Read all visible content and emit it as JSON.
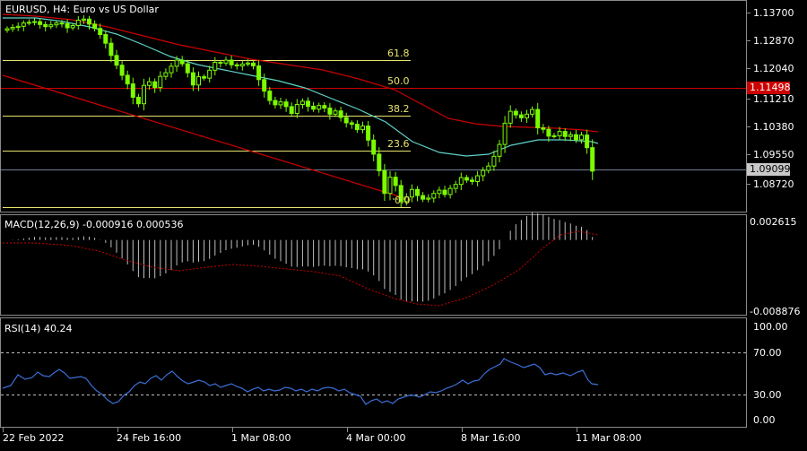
{
  "window": {
    "symbol_title": "EURUSD, H4:  Euro vs US Dollar"
  },
  "indicators": {
    "macd_label": "MACD(12,26,9) -0.000916 0.000536",
    "rsi_label": "RSI(14) 40.24"
  },
  "price_axis": {
    "ticks": [
      "1.13700",
      "1.12870",
      "1.12040",
      "1.11210",
      "1.10380",
      "1.09550",
      "1.08720"
    ],
    "current_price": "1.09099",
    "level_price": "1.11498",
    "level_color": "#cc0000",
    "current_color": "#c9c9c9"
  },
  "macd_axis": {
    "top": "0.002615",
    "bottom": "-0.008876"
  },
  "rsi_axis": {
    "ticks": [
      "100.00",
      "70.00",
      "30.00",
      "0.00"
    ]
  },
  "time_axis": {
    "labels": [
      "22 Feb 2022",
      "24 Feb 16:00",
      "1 Mar 08:00",
      "4 Mar 00:00",
      "8 Mar 16:00",
      "11 Mar 08:00"
    ]
  },
  "fibonacci": {
    "levels": [
      "61.8",
      "50.0",
      "38.2",
      "23.6",
      "0.0"
    ],
    "color": "#e8e36c"
  },
  "colors": {
    "background": "#000000",
    "bull_candle": "#7cfc00",
    "ma_fast": "#5fd3c8",
    "ma_slow": "#cc0000",
    "macd_hist": "#c0c0c0",
    "macd_signal": "#cc0000",
    "rsi_line": "#3b6fd6",
    "grid": "#444444"
  },
  "chart_data": [
    {
      "type": "candlestick",
      "title": "EURUSD, H4:  Euro vs US Dollar",
      "ylim": [
        1.082,
        1.14
      ],
      "close": [
        1.1325,
        1.1329,
        1.1332,
        1.1341,
        1.1343,
        1.1345,
        1.1337,
        1.1331,
        1.1336,
        1.1341,
        1.1339,
        1.1328,
        1.1334,
        1.1349,
        1.1352,
        1.1338,
        1.1326,
        1.1309,
        1.1285,
        1.1251,
        1.1224,
        1.1196,
        1.1172,
        1.1135,
        1.1117,
        1.1168,
        1.1178,
        1.1162,
        1.1193,
        1.1203,
        1.1221,
        1.1238,
        1.1228,
        1.1203,
        1.1169,
        1.1192,
        1.1188,
        1.121,
        1.1232,
        1.123,
        1.1238,
        1.1225,
        1.1222,
        1.1227,
        1.123,
        1.1222,
        1.1184,
        1.1152,
        1.1126,
        1.1114,
        1.1122,
        1.1109,
        1.109,
        1.1115,
        1.1124,
        1.111,
        1.1102,
        1.1112,
        1.1105,
        1.1088,
        1.1097,
        1.1079,
        1.1064,
        1.106,
        1.1045,
        1.1055,
        1.1016,
        1.0977,
        1.0931,
        1.0868,
        1.0913,
        1.089,
        1.0845,
        1.0858,
        1.0879,
        1.0862,
        1.0852,
        1.0855,
        1.0868,
        1.0877,
        1.0865,
        1.0882,
        1.0893,
        1.0912,
        1.0905,
        1.0901,
        1.0917,
        1.0932,
        1.0944,
        1.0971,
        1.1004,
        1.1063,
        1.1096,
        1.1086,
        1.1078,
        1.1088,
        1.1101,
        1.105,
        1.1046,
        1.1027,
        1.1028,
        1.104,
        1.1026,
        1.1031,
        1.1017,
        1.103,
        1.0995,
        1.093
      ]
    },
    {
      "type": "bar",
      "title": "MACD(12,26,9)",
      "ylim": [
        -0.008876,
        0.002615
      ],
      "current": {
        "macd": -0.000916,
        "signal": 0.000536
      }
    },
    {
      "type": "line",
      "title": "RSI(14)",
      "ylim": [
        0,
        100
      ],
      "levels": [
        70,
        30
      ],
      "current": 40.24
    }
  ]
}
